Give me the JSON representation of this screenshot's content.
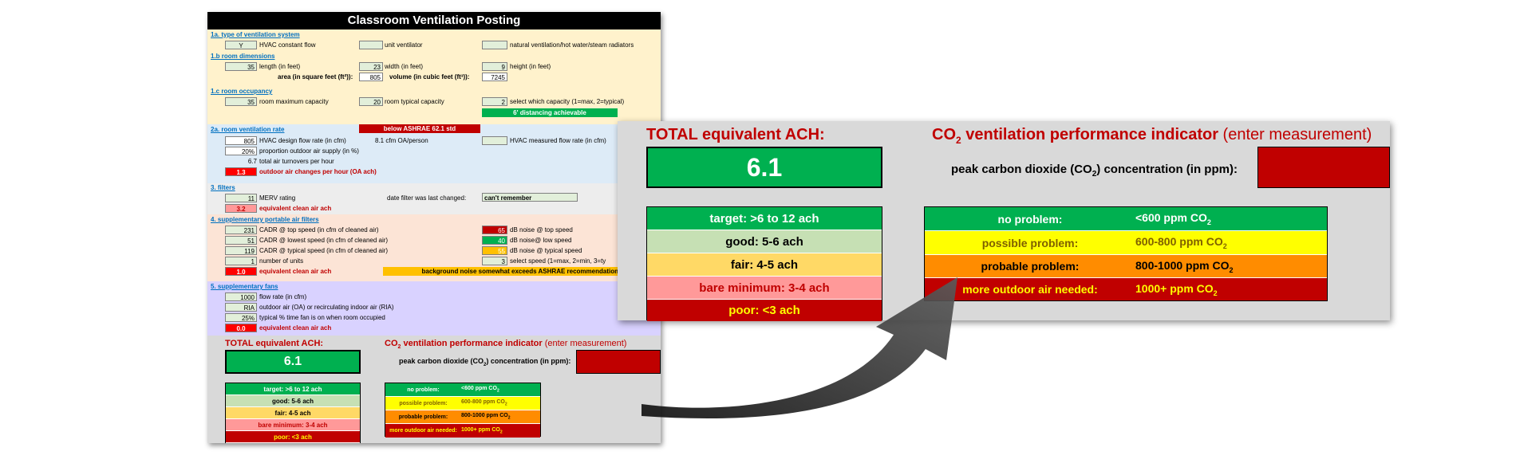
{
  "sheet": {
    "title": "Classroom Ventilation Posting",
    "s1a": {
      "heading": "1a. type of ventilation system",
      "hvac_value": "Y",
      "hvac_label": "HVAC constant flow",
      "unit_label": "unit ventilator",
      "natural_label": "natural ventilation/hot water/steam radiators"
    },
    "s1b": {
      "heading": "1.b room dimensions",
      "length_value": "35",
      "length_label": "length (in feet)",
      "width_value": "23",
      "width_label": "width (in feet)",
      "height_value": "9",
      "height_label": "height (in feet)",
      "area_label": "area (in square feet (ft²)):",
      "area_value": "805",
      "volume_label": "volume (in cubic feet (ft³)):",
      "volume_value": "7245"
    },
    "s1c": {
      "heading": "1.c room occupancy",
      "max_value": "35",
      "max_label": "room maximum capacity",
      "typical_value": "20",
      "typical_label": "room typical capacity",
      "select_value": "2",
      "select_label": "select which capacity (1=max, 2=typical)",
      "distancing": "6' distancing achievable"
    },
    "s2a": {
      "heading": "2a. room ventilation rate",
      "warning": "below ASHRAE 62.1 std",
      "design_value": "805",
      "design_label": "HVAC design flow rate (in cfm)",
      "cfm_person": "8.1 cfm OA/person",
      "measured_label": "HVAC measured flow rate (in cfm)",
      "outdoor_pct_value": "20%",
      "outdoor_pct_label": "proportion outdoor air supply (in %)",
      "turnovers_value": "6.7",
      "turnovers_label": "total air turnovers per hour",
      "oa_ach_value": "1.3",
      "oa_ach_label": "outdoor air changes per hour (OA ach)"
    },
    "s3": {
      "heading": "3. filters",
      "merv_value": "11",
      "merv_label": "MERV rating",
      "date_label": "date filter was last changed:",
      "date_value": "can't remember",
      "eq_value": "3.2",
      "eq_label": "equivalent clean air ach"
    },
    "s4": {
      "heading": "4. supplementary portable air filters",
      "top_value": "231",
      "top_label": "CADR @ top speed (in cfm of cleaned air)",
      "low_value": "51",
      "low_label": "CADR @ lowest speed (in cfm of cleaned air)",
      "typ_value": "119",
      "typ_label": "CADR @ typical speed (in cfm of cleaned air)",
      "units_value": "1",
      "units_label": "number of units",
      "eq_value": "1.0",
      "eq_label": "equivalent clean air ach",
      "db_top_value": "65",
      "db_top_label": "dB noise @ top speed",
      "db_low_value": "40",
      "db_low_label": "dB noise@ low speed",
      "db_typ_value": "55",
      "db_typ_label": "dB noise @ typical speed",
      "speed_value": "3",
      "speed_label": "select speed (1=max, 2=min, 3=ty",
      "noise_warning": "background noise somewhat exceeds ASHRAE recommendations"
    },
    "s5": {
      "heading": "5. supplementary fans",
      "flow_value": "1000",
      "flow_label": "flow rate (in cfm)",
      "oa_value": "RIA",
      "oa_label": "outdoor air (OA) or recirculating indoor air (RIA)",
      "pct_value": "25%",
      "pct_label": "typical % time fan is on when room occupied",
      "eq_value": "0.0",
      "eq_label": "equivalent clean air ach"
    }
  },
  "summary": {
    "total_label": "TOTAL equivalent ACH:",
    "total_value": "6.1",
    "co2_title_a": "CO",
    "co2_title_sub": "2",
    "co2_title_b": " ventilation performance indicator",
    "co2_title_c": " (enter measurement)",
    "peak_label_a": "peak carbon dioxide (CO",
    "peak_label_sub": "2",
    "peak_label_b": ") concentration (in ppm):",
    "ach_scale": [
      "target: >6 to 12 ach",
      "good:  5-6 ach",
      "fair:  4-5 ach",
      "bare minimum:  3-4 ach",
      "poor:  <3 ach"
    ],
    "co2_scale": [
      {
        "label": "no problem:",
        "range": "<600 ppm CO",
        "sub": "2"
      },
      {
        "label": "possible problem:",
        "range": "600-800 ppm CO",
        "sub": "2"
      },
      {
        "label": "probable problem:",
        "range": "800-1000 ppm CO",
        "sub": "2"
      },
      {
        "label": "more outdoor air needed:",
        "range": "1000+ ppm CO",
        "sub": "2"
      }
    ]
  },
  "colors": {
    "green": "#00b050",
    "dark_red": "#c00000",
    "yellow": "#ffff00",
    "orange": "#ff8c00"
  }
}
